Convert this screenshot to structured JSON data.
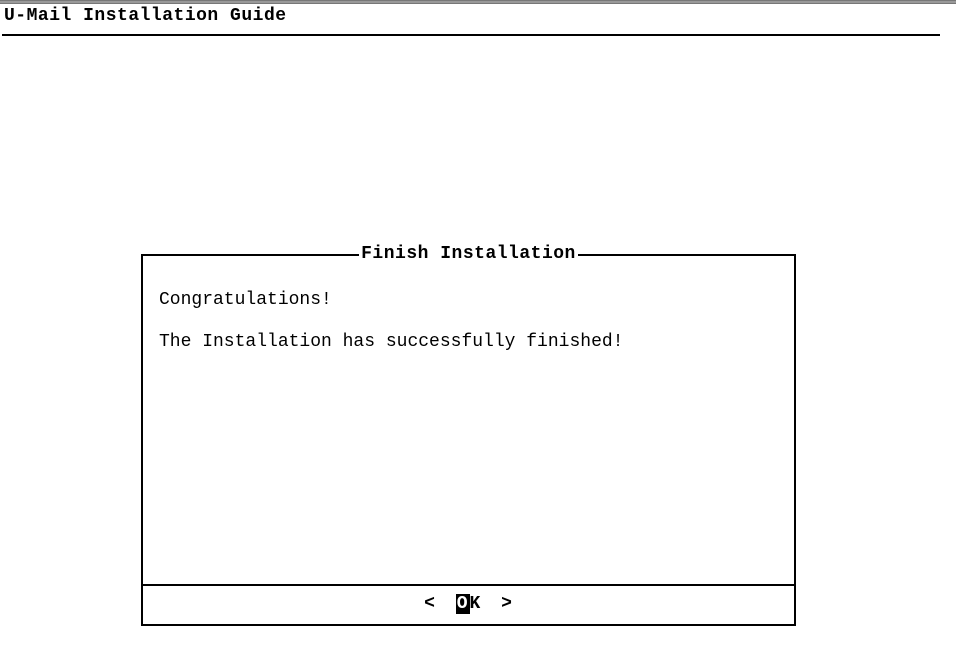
{
  "header": {
    "title": "U-Mail Installation Guide"
  },
  "dialog": {
    "title": "Finish Installation",
    "message_line1": "Congratulations!",
    "message_line2": "The Installation has successfully finished!",
    "ok_bracket_left": "<",
    "ok_letter_highlight": "O",
    "ok_letter_rest": "K",
    "ok_bracket_right": ">"
  }
}
